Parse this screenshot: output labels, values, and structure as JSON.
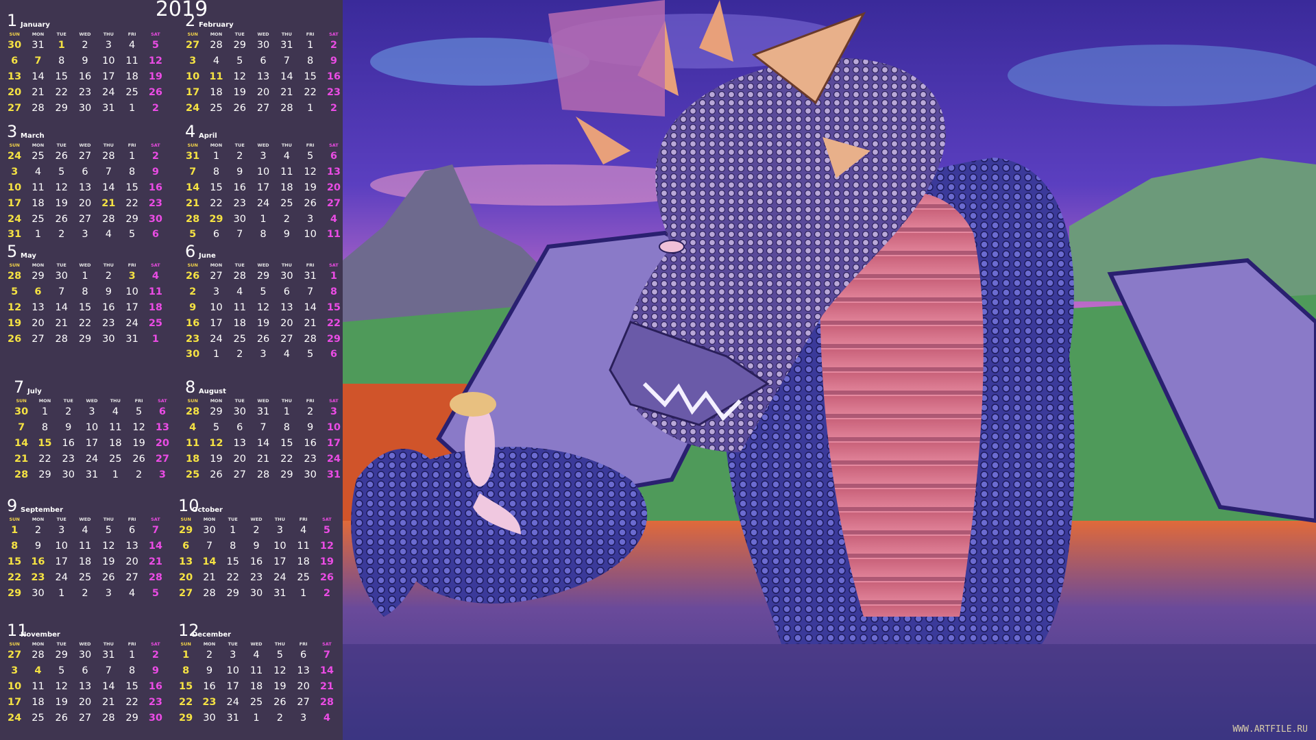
{
  "year": "2019",
  "day_headers": [
    "SUN",
    "MON",
    "TUE",
    "WED",
    "THU",
    "FRI",
    "SAT"
  ],
  "watermark": "WWW.ARTFILE.RU",
  "colors": {
    "panel": "#3f3550",
    "weekday": "#ffffff",
    "sunday": "#f5e243",
    "saturday": "#ea4ce4"
  },
  "months": [
    {
      "num": "1",
      "name": "January",
      "start": 30,
      "prevEnd": 31,
      "len": 31,
      "rows": 5,
      "hol": [
        1,
        7
      ]
    },
    {
      "num": "2",
      "name": "February",
      "start": 27,
      "prevEnd": 31,
      "len": 28,
      "rows": 5,
      "hol": [
        11
      ]
    },
    {
      "num": "3",
      "name": "March",
      "start": 24,
      "prevEnd": 28,
      "len": 31,
      "rows": 6,
      "hol": [
        21
      ]
    },
    {
      "num": "4",
      "name": "April",
      "start": 31,
      "prevEnd": 31,
      "len": 30,
      "rows": 6,
      "hol": [
        29
      ]
    },
    {
      "num": "5",
      "name": "May",
      "start": 28,
      "prevEnd": 30,
      "len": 31,
      "rows": 5,
      "hol": [
        3,
        4,
        6
      ]
    },
    {
      "num": "6",
      "name": "June",
      "start": 26,
      "prevEnd": 31,
      "len": 30,
      "rows": 6,
      "hol": []
    },
    {
      "num": "7",
      "name": "July",
      "start": 30,
      "prevEnd": 30,
      "len": 31,
      "rows": 5,
      "hol": [
        15
      ]
    },
    {
      "num": "8",
      "name": "August",
      "start": 28,
      "prevEnd": 31,
      "len": 31,
      "rows": 5,
      "hol": [
        12
      ]
    },
    {
      "num": "9",
      "name": "September",
      "start": 1,
      "prevEnd": 31,
      "len": 30,
      "rows": 5,
      "hol": [
        16,
        23
      ]
    },
    {
      "num": "10",
      "name": "October",
      "start": 29,
      "prevEnd": 30,
      "len": 31,
      "rows": 5,
      "hol": [
        14
      ]
    },
    {
      "num": "11",
      "name": "November",
      "start": 27,
      "prevEnd": 31,
      "len": 30,
      "rows": 5,
      "hol": [
        4
      ]
    },
    {
      "num": "12",
      "name": "December",
      "start": 1,
      "prevEnd": 30,
      "len": 31,
      "rows": 5,
      "hol": [
        23
      ]
    }
  ]
}
